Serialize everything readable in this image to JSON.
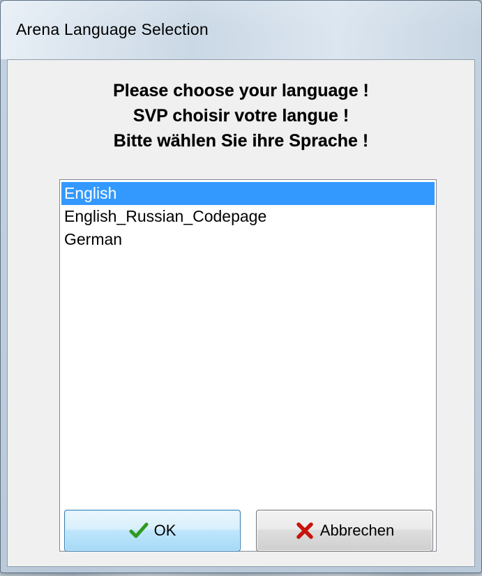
{
  "window": {
    "title": "Arena Language Selection"
  },
  "prompt": {
    "line1": "Please choose your language !",
    "line2": "SVP choisir votre langue !",
    "line3": "Bitte wählen Sie ihre Sprache !"
  },
  "languages": {
    "items": [
      {
        "label": "English",
        "selected": true
      },
      {
        "label": "English_Russian_Codepage",
        "selected": false
      },
      {
        "label": "German",
        "selected": false
      }
    ]
  },
  "buttons": {
    "ok_label": "OK",
    "ok_icon": "checkmark-icon",
    "cancel_label": "Abbrechen",
    "cancel_icon": "red-x-icon"
  },
  "colors": {
    "selection": "#3399ff",
    "ok_icon": "#2f9a1e",
    "cancel_icon": "#c8140c"
  }
}
